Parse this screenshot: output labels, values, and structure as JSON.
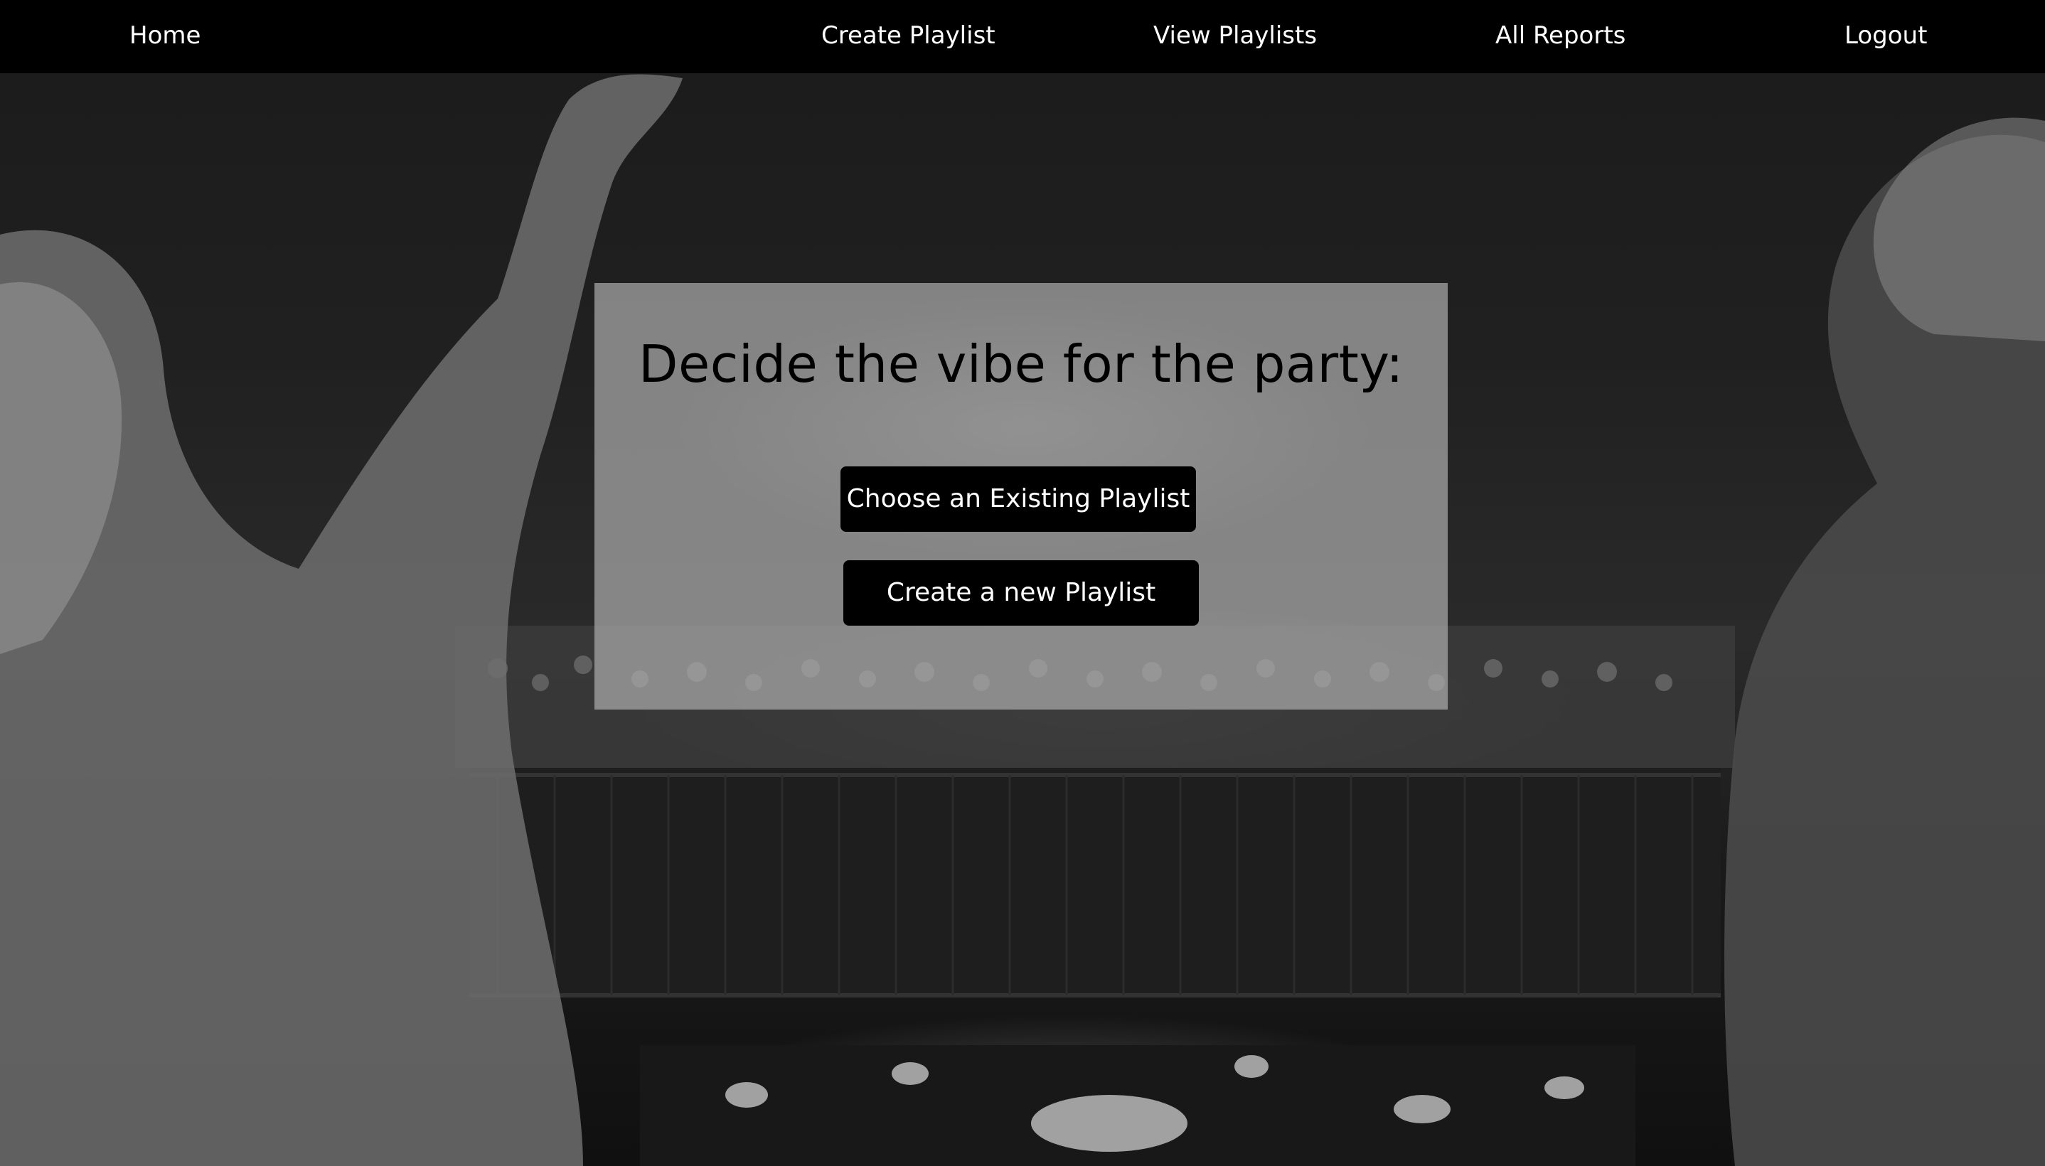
{
  "nav": {
    "home": "Home",
    "create_playlist": "Create Playlist",
    "view_playlists": "View Playlists",
    "all_reports": "All Reports",
    "logout": "Logout"
  },
  "main": {
    "title": "Decide the vibe for the party:",
    "choose_existing_label": "Choose an Existing Playlist",
    "create_new_label": "Create a new Playlist"
  },
  "colors": {
    "navbar_bg": "#000000",
    "button_bg": "#000000",
    "button_text": "#ffffff",
    "card_bg": "#aaaaaa"
  },
  "background": {
    "image_subject": "black-and-white concert photo with DJs in foreground and crowd behind barrier"
  }
}
